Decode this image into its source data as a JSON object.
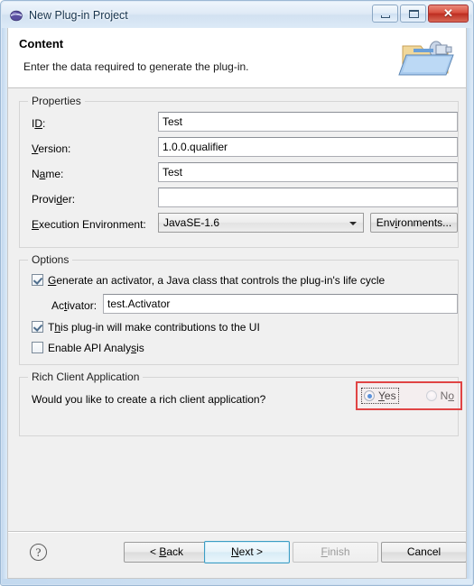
{
  "window": {
    "title": "New Plug-in Project",
    "icon": "eclipse-icon",
    "minimize_label": "",
    "maximize_label": "",
    "close_label": "✕"
  },
  "header": {
    "title": "Content",
    "subtitle": "Enter the data required to generate the plug-in.",
    "banner_icon": "plugin-folder-icon"
  },
  "properties": {
    "group_title": "Properties",
    "fields": [
      {
        "label_pre": "I",
        "label_mn": "D",
        "label_post": ":",
        "value": "Test",
        "name": "id"
      },
      {
        "label_pre": "",
        "label_mn": "V",
        "label_post": "ersion:",
        "value": "1.0.0.qualifier",
        "name": "version"
      },
      {
        "label_pre": "N",
        "label_mn": "a",
        "label_post": "me:",
        "value": "Test",
        "name": "name"
      },
      {
        "label_pre": "Provi",
        "label_mn": "d",
        "label_post": "er:",
        "value": "",
        "name": "provider"
      }
    ],
    "execution_environment": {
      "label_pre": "",
      "label_mn": "E",
      "label_post": "xecution Environment:",
      "value": "JavaSE-1.6",
      "button_pre": "Env",
      "button_mn": "i",
      "button_post": "ronments..."
    }
  },
  "options": {
    "group_title": "Options",
    "generate_activator": {
      "checked": true,
      "label_pre": "",
      "label_mn": "G",
      "label_post": "enerate an activator, a Java class that controls the plug-in's life cycle"
    },
    "activator": {
      "label_pre": "Ac",
      "label_mn": "t",
      "label_post": "ivator:",
      "value": "test.Activator"
    },
    "ui_contributions": {
      "checked": true,
      "label_pre": "T",
      "label_mn": "h",
      "label_post": "is plug-in will make contributions to the UI"
    },
    "api_analysis": {
      "checked": false,
      "label_pre": "Enable API Analy",
      "label_mn": "s",
      "label_post": "is"
    }
  },
  "rich_client": {
    "group_title": "Rich Client Application",
    "question": "Would you like to create a rich client application?",
    "options": [
      {
        "label_pre": "",
        "label_mn": "Y",
        "label_post": "es",
        "selected": true
      },
      {
        "label_pre": "N",
        "label_mn": "o",
        "label_post": "",
        "selected": false
      }
    ],
    "highlight_color": "#e04444"
  },
  "footer": {
    "help_glyph": "?",
    "buttons": [
      {
        "pre": "< ",
        "mn": "B",
        "post": "ack",
        "state": "enabled",
        "name": "back"
      },
      {
        "pre": "",
        "mn": "N",
        "post": "ext >",
        "state": "default",
        "name": "next"
      },
      {
        "pre": "",
        "mn": "F",
        "post": "inish",
        "state": "disabled",
        "name": "finish"
      },
      {
        "pre": "Cancel",
        "mn": "",
        "post": "",
        "state": "enabled",
        "name": "cancel"
      }
    ]
  }
}
